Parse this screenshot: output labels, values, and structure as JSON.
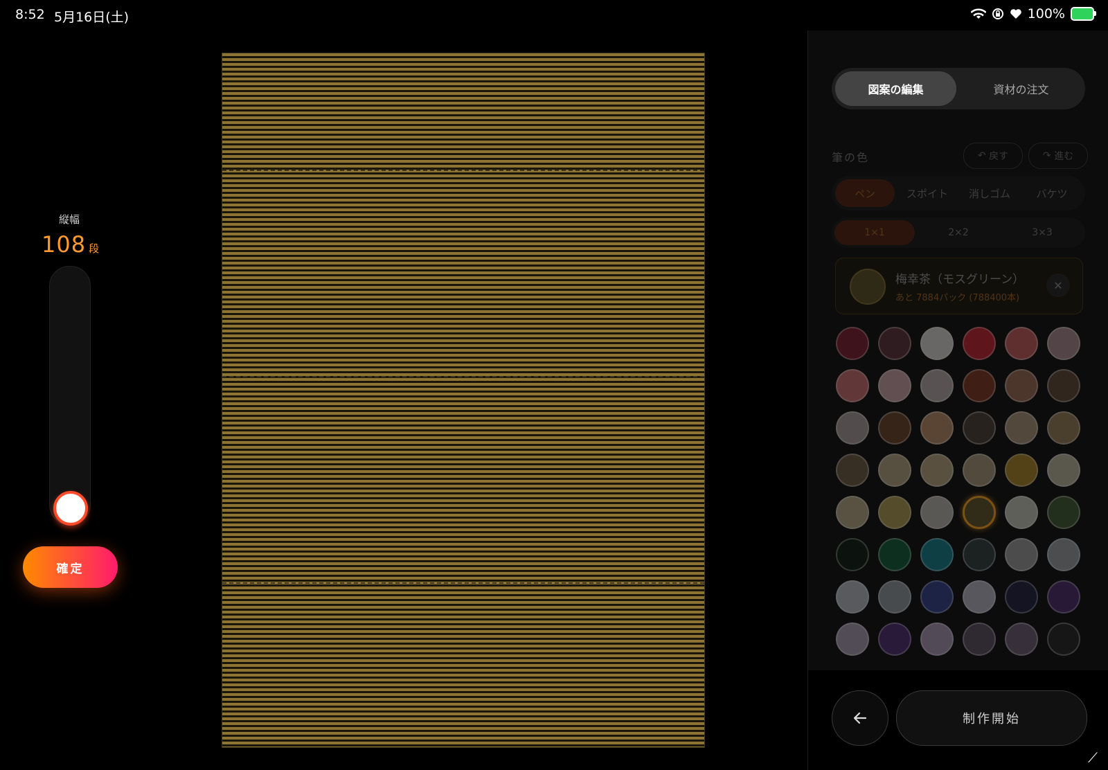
{
  "status_bar": {
    "time": "8:52",
    "date": "5月16日(土)",
    "battery": "100%"
  },
  "height_control": {
    "label": "縦幅",
    "value": "108",
    "unit": "段",
    "confirm_label": "確定"
  },
  "panel": {
    "tabs": [
      {
        "label": "図案の編集",
        "active": true
      },
      {
        "label": "資材の注文",
        "active": false
      }
    ],
    "section_title": "筆の色",
    "undo_label": "戻す",
    "redo_label": "進む",
    "tools": [
      {
        "label": "ペン",
        "active": true
      },
      {
        "label": "スポイト",
        "active": false
      },
      {
        "label": "消しゴム",
        "active": false
      },
      {
        "label": "バケツ",
        "active": false
      }
    ],
    "sizes": [
      {
        "label": "1×1",
        "active": true
      },
      {
        "label": "2×2",
        "active": false
      },
      {
        "label": "3×3",
        "active": false
      }
    ],
    "selected_color": {
      "name": "梅幸茶（モスグリーン）",
      "remaining": "あと 7884パック (788400本)",
      "hex": "#8a7a2e"
    },
    "palette": [
      [
        "#7a1b2e",
        "#5a3038",
        "#d9d4d0",
        "#c21f30",
        "#c45a5a",
        "#a88a8e"
      ],
      [
        "#c96b6b",
        "#c7a0a4",
        "#b3a8a6",
        "#7d3320",
        "#9a6650",
        "#5e4534"
      ],
      [
        "#a8999a",
        "#6b4127",
        "#b98a66",
        "#4a3d33",
        "#a89076",
        "#967a52"
      ],
      [
        "#6e5a41",
        "#b2a07c",
        "#b5a27e",
        "#a69675",
        "#a88226",
        "#b9b39b"
      ],
      [
        "#b5a684",
        "#aa9a4e",
        "#b5b3ae",
        "#5c5326",
        "#c3c4b6",
        "#3f5a32"
      ],
      [
        "#0c1c12",
        "#0e5a36",
        "#0f7d8a",
        "#2f3c3c",
        "#9a9a9a",
        "#9a9ca0"
      ],
      [
        "#b4b8be",
        "#8f979c",
        "#2f3f8a",
        "#b5b2c2",
        "#1e1e3e",
        "#4a2a6a"
      ],
      [
        "#a69ab0",
        "#4a2a6e",
        "#a994b4",
        "#5a4c60",
        "#6c5a70",
        "#242224"
      ]
    ],
    "selected_palette_index": [
      4,
      3
    ],
    "back_icon": "arrow-left-icon",
    "start_label": "制作開始"
  }
}
